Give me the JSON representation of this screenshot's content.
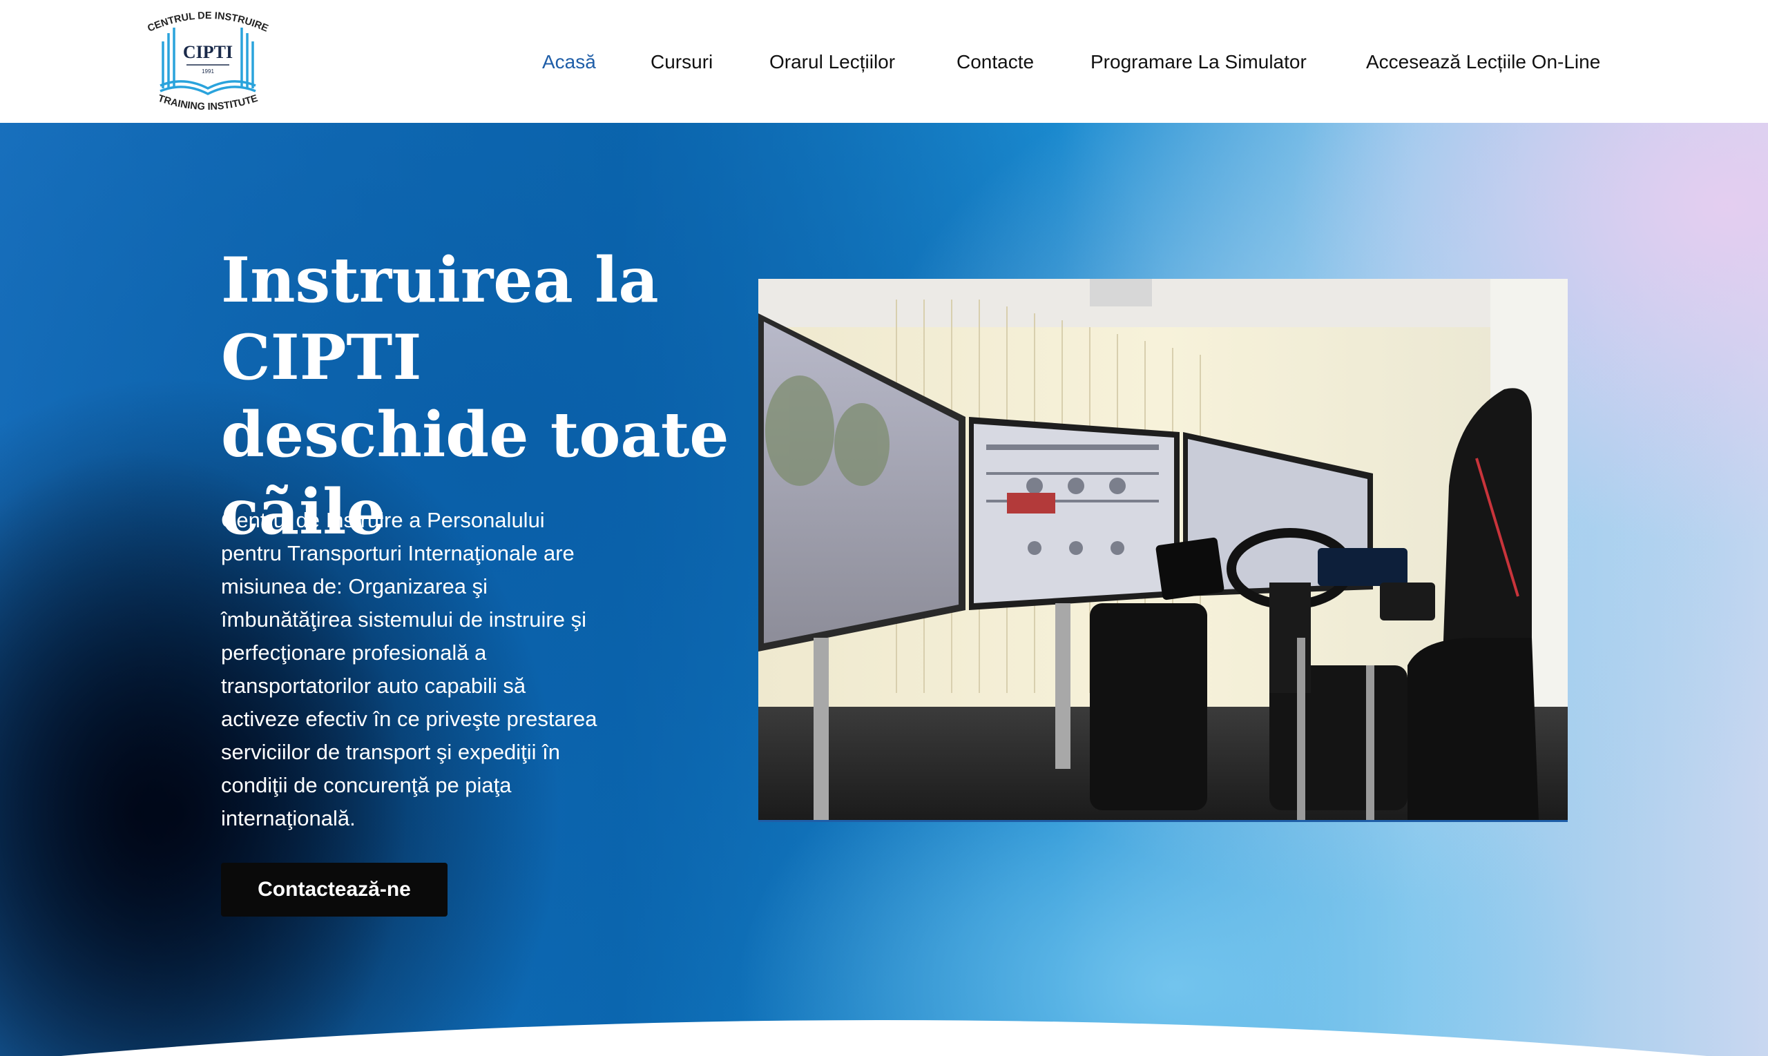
{
  "logo": {
    "top_text": "CENTRUL DE INSTRUIRE",
    "name": "CIPTI",
    "year": "1991",
    "bottom_text": "TRAINING INSTITUTE"
  },
  "nav": {
    "items": [
      "Acasă",
      "Cursuri",
      "Orarul Lecțiilor",
      "Contacte",
      "Programare La Simulator",
      "Accesează Lecțiile On-Line"
    ],
    "active": "Acasă",
    "active_color": "#1f5ea8"
  },
  "hero": {
    "title": "Instruirea la CIPTI deschide toate cãile",
    "description": "Centrul de Instruire a Personalului pentru Transporturi Internaţionale are misiunea de: Organizarea şi îmbunătăţirea sistemului de instruire şi perfecţionare profesională a transportatorilor auto capabili să activeze efectiv în ce priveşte prestarea serviciilor de transport şi expediţii în condiţii de concurenţă pe piaţa internaţională.",
    "cta_label": "Contactează-ne"
  },
  "colors": {
    "accent": "#1f5ea8",
    "cta_bg": "#0a0a0a",
    "logo_blue": "#2aa3dc"
  }
}
